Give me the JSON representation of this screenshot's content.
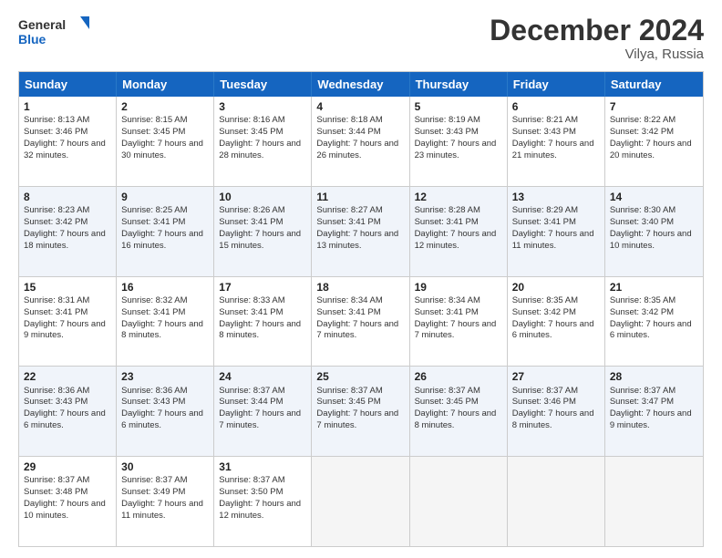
{
  "header": {
    "title": "December 2024",
    "subtitle": "Vilya, Russia",
    "logo_line1": "General",
    "logo_line2": "Blue"
  },
  "weekdays": [
    "Sunday",
    "Monday",
    "Tuesday",
    "Wednesday",
    "Thursday",
    "Friday",
    "Saturday"
  ],
  "rows": [
    {
      "alt": false,
      "cells": [
        {
          "day": "1",
          "sunrise": "Sunrise: 8:13 AM",
          "sunset": "Sunset: 3:46 PM",
          "daylight": "Daylight: 7 hours and 32 minutes."
        },
        {
          "day": "2",
          "sunrise": "Sunrise: 8:15 AM",
          "sunset": "Sunset: 3:45 PM",
          "daylight": "Daylight: 7 hours and 30 minutes."
        },
        {
          "day": "3",
          "sunrise": "Sunrise: 8:16 AM",
          "sunset": "Sunset: 3:45 PM",
          "daylight": "Daylight: 7 hours and 28 minutes."
        },
        {
          "day": "4",
          "sunrise": "Sunrise: 8:18 AM",
          "sunset": "Sunset: 3:44 PM",
          "daylight": "Daylight: 7 hours and 26 minutes."
        },
        {
          "day": "5",
          "sunrise": "Sunrise: 8:19 AM",
          "sunset": "Sunset: 3:43 PM",
          "daylight": "Daylight: 7 hours and 23 minutes."
        },
        {
          "day": "6",
          "sunrise": "Sunrise: 8:21 AM",
          "sunset": "Sunset: 3:43 PM",
          "daylight": "Daylight: 7 hours and 21 minutes."
        },
        {
          "day": "7",
          "sunrise": "Sunrise: 8:22 AM",
          "sunset": "Sunset: 3:42 PM",
          "daylight": "Daylight: 7 hours and 20 minutes."
        }
      ]
    },
    {
      "alt": true,
      "cells": [
        {
          "day": "8",
          "sunrise": "Sunrise: 8:23 AM",
          "sunset": "Sunset: 3:42 PM",
          "daylight": "Daylight: 7 hours and 18 minutes."
        },
        {
          "day": "9",
          "sunrise": "Sunrise: 8:25 AM",
          "sunset": "Sunset: 3:41 PM",
          "daylight": "Daylight: 7 hours and 16 minutes."
        },
        {
          "day": "10",
          "sunrise": "Sunrise: 8:26 AM",
          "sunset": "Sunset: 3:41 PM",
          "daylight": "Daylight: 7 hours and 15 minutes."
        },
        {
          "day": "11",
          "sunrise": "Sunrise: 8:27 AM",
          "sunset": "Sunset: 3:41 PM",
          "daylight": "Daylight: 7 hours and 13 minutes."
        },
        {
          "day": "12",
          "sunrise": "Sunrise: 8:28 AM",
          "sunset": "Sunset: 3:41 PM",
          "daylight": "Daylight: 7 hours and 12 minutes."
        },
        {
          "day": "13",
          "sunrise": "Sunrise: 8:29 AM",
          "sunset": "Sunset: 3:41 PM",
          "daylight": "Daylight: 7 hours and 11 minutes."
        },
        {
          "day": "14",
          "sunrise": "Sunrise: 8:30 AM",
          "sunset": "Sunset: 3:40 PM",
          "daylight": "Daylight: 7 hours and 10 minutes."
        }
      ]
    },
    {
      "alt": false,
      "cells": [
        {
          "day": "15",
          "sunrise": "Sunrise: 8:31 AM",
          "sunset": "Sunset: 3:41 PM",
          "daylight": "Daylight: 7 hours and 9 minutes."
        },
        {
          "day": "16",
          "sunrise": "Sunrise: 8:32 AM",
          "sunset": "Sunset: 3:41 PM",
          "daylight": "Daylight: 7 hours and 8 minutes."
        },
        {
          "day": "17",
          "sunrise": "Sunrise: 8:33 AM",
          "sunset": "Sunset: 3:41 PM",
          "daylight": "Daylight: 7 hours and 8 minutes."
        },
        {
          "day": "18",
          "sunrise": "Sunrise: 8:34 AM",
          "sunset": "Sunset: 3:41 PM",
          "daylight": "Daylight: 7 hours and 7 minutes."
        },
        {
          "day": "19",
          "sunrise": "Sunrise: 8:34 AM",
          "sunset": "Sunset: 3:41 PM",
          "daylight": "Daylight: 7 hours and 7 minutes."
        },
        {
          "day": "20",
          "sunrise": "Sunrise: 8:35 AM",
          "sunset": "Sunset: 3:42 PM",
          "daylight": "Daylight: 7 hours and 6 minutes."
        },
        {
          "day": "21",
          "sunrise": "Sunrise: 8:35 AM",
          "sunset": "Sunset: 3:42 PM",
          "daylight": "Daylight: 7 hours and 6 minutes."
        }
      ]
    },
    {
      "alt": true,
      "cells": [
        {
          "day": "22",
          "sunrise": "Sunrise: 8:36 AM",
          "sunset": "Sunset: 3:43 PM",
          "daylight": "Daylight: 7 hours and 6 minutes."
        },
        {
          "day": "23",
          "sunrise": "Sunrise: 8:36 AM",
          "sunset": "Sunset: 3:43 PM",
          "daylight": "Daylight: 7 hours and 6 minutes."
        },
        {
          "day": "24",
          "sunrise": "Sunrise: 8:37 AM",
          "sunset": "Sunset: 3:44 PM",
          "daylight": "Daylight: 7 hours and 7 minutes."
        },
        {
          "day": "25",
          "sunrise": "Sunrise: 8:37 AM",
          "sunset": "Sunset: 3:45 PM",
          "daylight": "Daylight: 7 hours and 7 minutes."
        },
        {
          "day": "26",
          "sunrise": "Sunrise: 8:37 AM",
          "sunset": "Sunset: 3:45 PM",
          "daylight": "Daylight: 7 hours and 8 minutes."
        },
        {
          "day": "27",
          "sunrise": "Sunrise: 8:37 AM",
          "sunset": "Sunset: 3:46 PM",
          "daylight": "Daylight: 7 hours and 8 minutes."
        },
        {
          "day": "28",
          "sunrise": "Sunrise: 8:37 AM",
          "sunset": "Sunset: 3:47 PM",
          "daylight": "Daylight: 7 hours and 9 minutes."
        }
      ]
    },
    {
      "alt": false,
      "cells": [
        {
          "day": "29",
          "sunrise": "Sunrise: 8:37 AM",
          "sunset": "Sunset: 3:48 PM",
          "daylight": "Daylight: 7 hours and 10 minutes."
        },
        {
          "day": "30",
          "sunrise": "Sunrise: 8:37 AM",
          "sunset": "Sunset: 3:49 PM",
          "daylight": "Daylight: 7 hours and 11 minutes."
        },
        {
          "day": "31",
          "sunrise": "Sunrise: 8:37 AM",
          "sunset": "Sunset: 3:50 PM",
          "daylight": "Daylight: 7 hours and 12 minutes."
        },
        {
          "day": "",
          "sunrise": "",
          "sunset": "",
          "daylight": ""
        },
        {
          "day": "",
          "sunrise": "",
          "sunset": "",
          "daylight": ""
        },
        {
          "day": "",
          "sunrise": "",
          "sunset": "",
          "daylight": ""
        },
        {
          "day": "",
          "sunrise": "",
          "sunset": "",
          "daylight": ""
        }
      ]
    }
  ]
}
